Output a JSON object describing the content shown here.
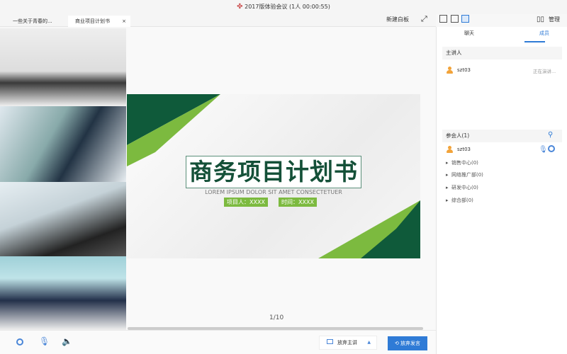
{
  "window": {
    "title": "2017版体验会议 (1人 00:00:55)"
  },
  "tabs": [
    {
      "label": "一些关于青春的..."
    },
    {
      "label": "商业项目计划书",
      "close": "×"
    }
  ],
  "toolbar": {
    "new_whiteboard": "新建白板",
    "manage": "管理"
  },
  "slide": {
    "title": "商务项目计划书",
    "subtitle": "LOREM IPSUM DOLOR SIT AMET CONSECTETUER",
    "presenter_badge": "项目人：XXXX",
    "time_badge": "时间：XXXX",
    "page": "1/10"
  },
  "right_panel": {
    "tabs": [
      {
        "label": "聊天"
      },
      {
        "label": "成员"
      }
    ],
    "presenter_header": "主讲人",
    "presenter": {
      "name": "szt03",
      "status": "正在演讲..."
    },
    "participants_header": "参会人(1)",
    "participant": {
      "name": "szt03"
    },
    "groups": [
      "销售中心(0)",
      "网络推广部(0)",
      "研发中心(0)",
      "综合部(0)"
    ]
  },
  "bottom": {
    "give_up_presenter": "放弃主讲",
    "give_up_speaking": "放弃发言"
  },
  "colors": {
    "accent": "#2f7bd6",
    "dark_green": "#145038",
    "light_green": "#7cba3f"
  }
}
